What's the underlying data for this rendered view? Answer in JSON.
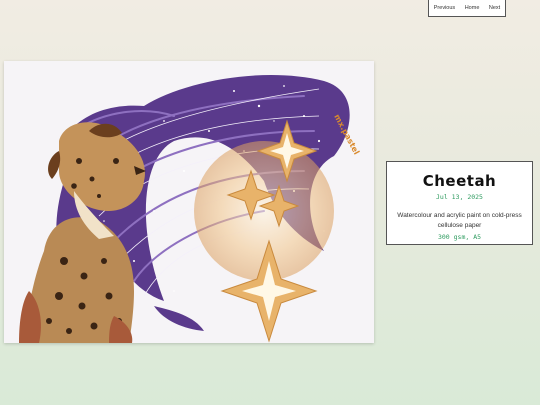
{
  "nav": {
    "previous": "Previous",
    "home": "Home",
    "next": "Next"
  },
  "artwork": {
    "signature": "mx.pastel"
  },
  "card": {
    "title": "Cheetah",
    "date": "Jul 13, 2025",
    "medium": "Watercolour and acrylic paint on cold-press cellulose paper",
    "size": "300 gsm, A5"
  },
  "colors": {
    "accent": "#2e9b5f",
    "hair_purple": "#5a3a8c",
    "star_gold": "#e8b36a",
    "fur_brown": "#8a5a2e"
  }
}
